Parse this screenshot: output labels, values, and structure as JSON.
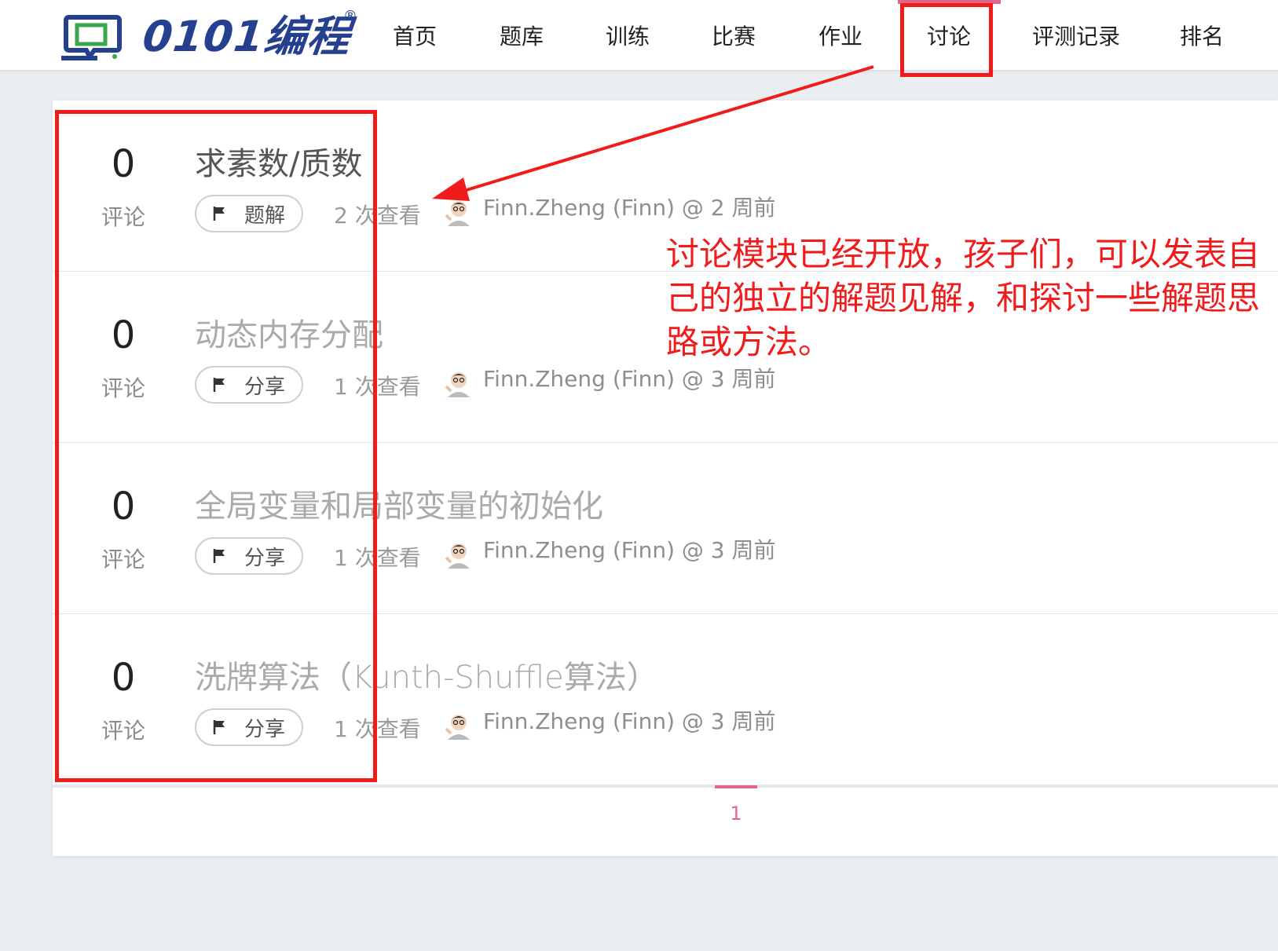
{
  "header": {
    "logo_text": "0101编程",
    "logo_reg": "®",
    "nav": [
      {
        "label": "首页"
      },
      {
        "label": "题库"
      },
      {
        "label": "训练"
      },
      {
        "label": "比赛"
      },
      {
        "label": "作业"
      },
      {
        "label": "讨论"
      },
      {
        "label": "评测记录"
      },
      {
        "label": "排名"
      }
    ],
    "active_nav": "讨论"
  },
  "discussions": [
    {
      "comment_count": "0",
      "comment_label": "评论",
      "title": "求素数/质数",
      "tag": "题解",
      "views": "2 次查看",
      "author_meta": "Finn.Zheng (Finn) @ 2 周前"
    },
    {
      "comment_count": "0",
      "comment_label": "评论",
      "title": "动态内存分配",
      "tag": "分享",
      "views": "1 次查看",
      "author_meta": "Finn.Zheng (Finn) @ 3 周前"
    },
    {
      "comment_count": "0",
      "comment_label": "评论",
      "title": "全局变量和局部变量的初始化",
      "tag": "分享",
      "views": "1 次查看",
      "author_meta": "Finn.Zheng (Finn) @ 3 周前"
    },
    {
      "comment_count": "0",
      "comment_label": "评论",
      "title": "洗牌算法（Kunth-Shuffle算法）",
      "tag": "分享",
      "views": "1 次查看",
      "author_meta": "Finn.Zheng (Finn) @ 3 周前"
    }
  ],
  "pagination": {
    "current_page": "1"
  },
  "annotation": {
    "text": "讨论模块已经开放，孩子们，可以发表自己的独立的解题见解，和探讨一些解题思路或方法。",
    "color": "#f01c1c"
  },
  "colors": {
    "brand": "#24408f",
    "accent": "#e0678a"
  }
}
